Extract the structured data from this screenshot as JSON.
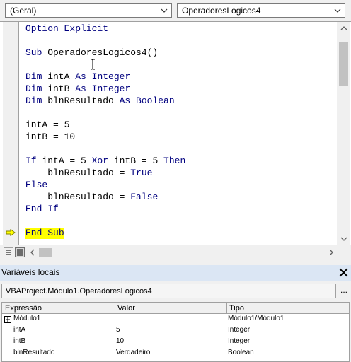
{
  "dropdowns": {
    "object": "(Geral)",
    "procedure": "OperadoresLogicos4"
  },
  "code": {
    "option_line": "Option Explicit",
    "lines": [
      {
        "kw1": "Sub",
        "rest": " OperadoresLogicos4()"
      },
      {
        "kw1": "Dim",
        "mid": " intA ",
        "kw2": "As",
        "sp": " ",
        "kw3": "Integer"
      },
      {
        "kw1": "Dim",
        "mid": " intB ",
        "kw2": "As",
        "sp": " ",
        "kw3": "Integer"
      },
      {
        "kw1": "Dim",
        "mid": " blnResultado ",
        "kw2": "As",
        "sp": " ",
        "kw3": "Boolean"
      },
      {
        "text": "intA = 5"
      },
      {
        "text": "intB = 10"
      },
      {
        "kw1": "If",
        "mid": " intA = 5 ",
        "kw2": "Xor",
        "mid2": " intB = 5 ",
        "kw3": "Then"
      },
      {
        "mid": "    blnResultado = ",
        "kw1": "True"
      },
      {
        "kw1": "Else"
      },
      {
        "mid": "    blnResultado = ",
        "kw1": "False"
      },
      {
        "kw1": "End",
        "sp": " ",
        "kw2": "If"
      },
      {
        "kw1": "End",
        "sp": " ",
        "kw2": "Sub"
      }
    ]
  },
  "locals": {
    "title": "Variáveis locais",
    "context": "VBAProject.Módulo1.OperadoresLogicos4",
    "ellipsis": "...",
    "columns": [
      "Expressão",
      "Valor",
      "Tipo"
    ],
    "rows": [
      {
        "expr": "Módulo1",
        "value": "",
        "type": "Módulo1/Módulo1"
      },
      {
        "expr": "intA",
        "value": "5",
        "type": "Integer"
      },
      {
        "expr": "intB",
        "value": "10",
        "type": "Integer"
      },
      {
        "expr": "blnResultado",
        "value": "Verdadeiro",
        "type": "Boolean"
      }
    ]
  },
  "colors": {
    "keyword": "#00007f",
    "highlight": "#ffff00",
    "panel_title_bg": "#dbe6f4"
  },
  "icons": {
    "dropdown": "chevron-down-icon",
    "execution_pointer": "yellow-arrow-icon",
    "close": "close-icon",
    "expand": "plus-box-icon"
  }
}
